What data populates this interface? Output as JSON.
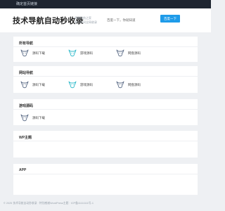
{
  "topbar": {
    "link": "确定首页链接"
  },
  "header": {
    "title": "技术导航自动秒收录",
    "subtitle_line1": "再创导航之家",
    "subtitle_line2": "第一时间全网收录",
    "search_placeholder": "百度一下，你就知道",
    "search_button": "百度一下"
  },
  "sections": [
    {
      "title": "所有导航",
      "items": [
        {
          "label": "源码下载",
          "icon": "bull-icon",
          "color": "#5b6b86"
        },
        {
          "label": "游戏源码",
          "icon": "bull-icon",
          "color": "#2bb8c9"
        },
        {
          "label": "网盘源码",
          "icon": "bull-icon",
          "color": "#5b6b86"
        }
      ]
    },
    {
      "title": "网站导航",
      "items": [
        {
          "label": "源码下载",
          "icon": "bull-icon",
          "color": "#5b6b86"
        },
        {
          "label": "游戏源码",
          "icon": "bull-icon",
          "color": "#2bb8c9"
        },
        {
          "label": "网盘源码",
          "icon": "bull-icon",
          "color": "#5b6b86"
        }
      ]
    },
    {
      "title": "游戏源码",
      "items": [
        {
          "label": "源码下载",
          "icon": "bull-icon",
          "color": "#5b6b86"
        }
      ]
    },
    {
      "title": "WP主题",
      "items": []
    },
    {
      "title": "APP",
      "items": []
    }
  ],
  "footer": {
    "text": "© 2025 技术导航自动秒收录 · 特别感谢WordPress主题 · ICP备11111111号-1"
  },
  "colors": {
    "accent": "#1e9be9",
    "topbar": "#1e2530"
  }
}
